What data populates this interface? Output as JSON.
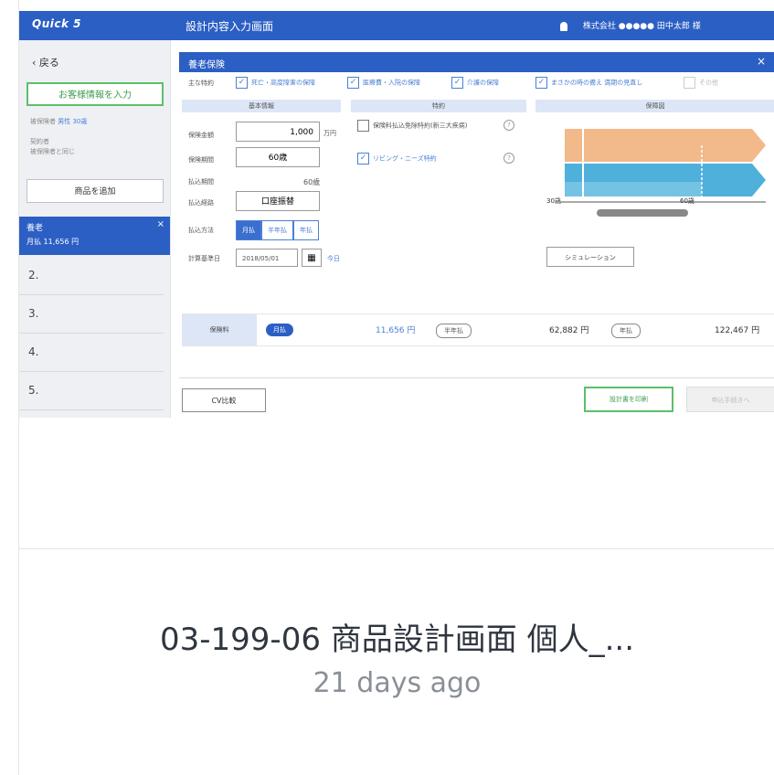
{
  "app": {
    "logo": "Quick 5",
    "screen_title": "設計内容入力画面",
    "user_text": "株式会社 ●●●●●  田中太郎 様"
  },
  "sidebar": {
    "back_label": "戻る",
    "customer_button": "お客様情報を入力",
    "meta_label_1": "被保険者",
    "meta_value_1": "男性 30歳",
    "meta_label_2": "契約者",
    "meta_value_2": "被保険者と同じ",
    "add_product_button": "商品を追加",
    "active_plan": {
      "label": "養老",
      "badge": "月払",
      "amount": "11,656 円"
    },
    "plans": [
      "2.",
      "3.",
      "4.",
      "5."
    ]
  },
  "main": {
    "section_title": "養老保険",
    "options_label": "主な特約",
    "options": [
      {
        "label": "死亡・高度障害の保障",
        "checked": true
      },
      {
        "label": "医療費・入院の保障",
        "checked": true
      },
      {
        "label": "介護の保障",
        "checked": true
      },
      {
        "label": "まさかの時の備え 満期の見直し",
        "checked": true
      },
      {
        "label": "その他",
        "checked": false
      }
    ],
    "panels": {
      "basic": "基本情報",
      "rider": "特約",
      "figure": "保障図"
    },
    "fields": {
      "amount_label": "保険金額",
      "amount_value": "1,000",
      "amount_unit": "万円",
      "period_label": "保険期間",
      "period_value": "60歳",
      "pay_period_label": "払込期間",
      "pay_period_value": "60歳",
      "pay_route_label": "払込経路",
      "pay_route_value": "口座振替",
      "pay_method_label": "払込方法",
      "pay_methods": [
        "月払",
        "半年払",
        "年払"
      ],
      "calc_date_label": "計算基準日",
      "calc_date_value": "2018/05/01",
      "today_link": "今日"
    },
    "riders": [
      {
        "label": "保険料払込免除特約(新三大疾病)",
        "checked": false
      },
      {
        "label": "リビング・ニーズ特約",
        "checked": true
      }
    ],
    "diagram": {
      "start": "30歳",
      "end": "60歳"
    },
    "simulation_button": "シミュレーション",
    "premium": {
      "label": "保険料",
      "items": [
        {
          "pill": "月払",
          "amount": "11,656 円",
          "active": true
        },
        {
          "pill": "半年払",
          "amount": "62,882 円",
          "active": false
        },
        {
          "pill": "年払",
          "amount": "122,467 円",
          "active": false
        }
      ]
    },
    "footer": {
      "cv_button": "CV比較",
      "print_button": "設計書を印刷",
      "next_button": "申込手続きへ"
    }
  },
  "caption": {
    "title": "03-199-06 商品設計画面 個人_...",
    "subtitle": "21 days ago"
  },
  "colors": {
    "brand": "#2c5fc4",
    "accent_green": "#5cbf6b",
    "diagram_orange": "#f2b98a",
    "diagram_blue": "#4fb0dc"
  }
}
